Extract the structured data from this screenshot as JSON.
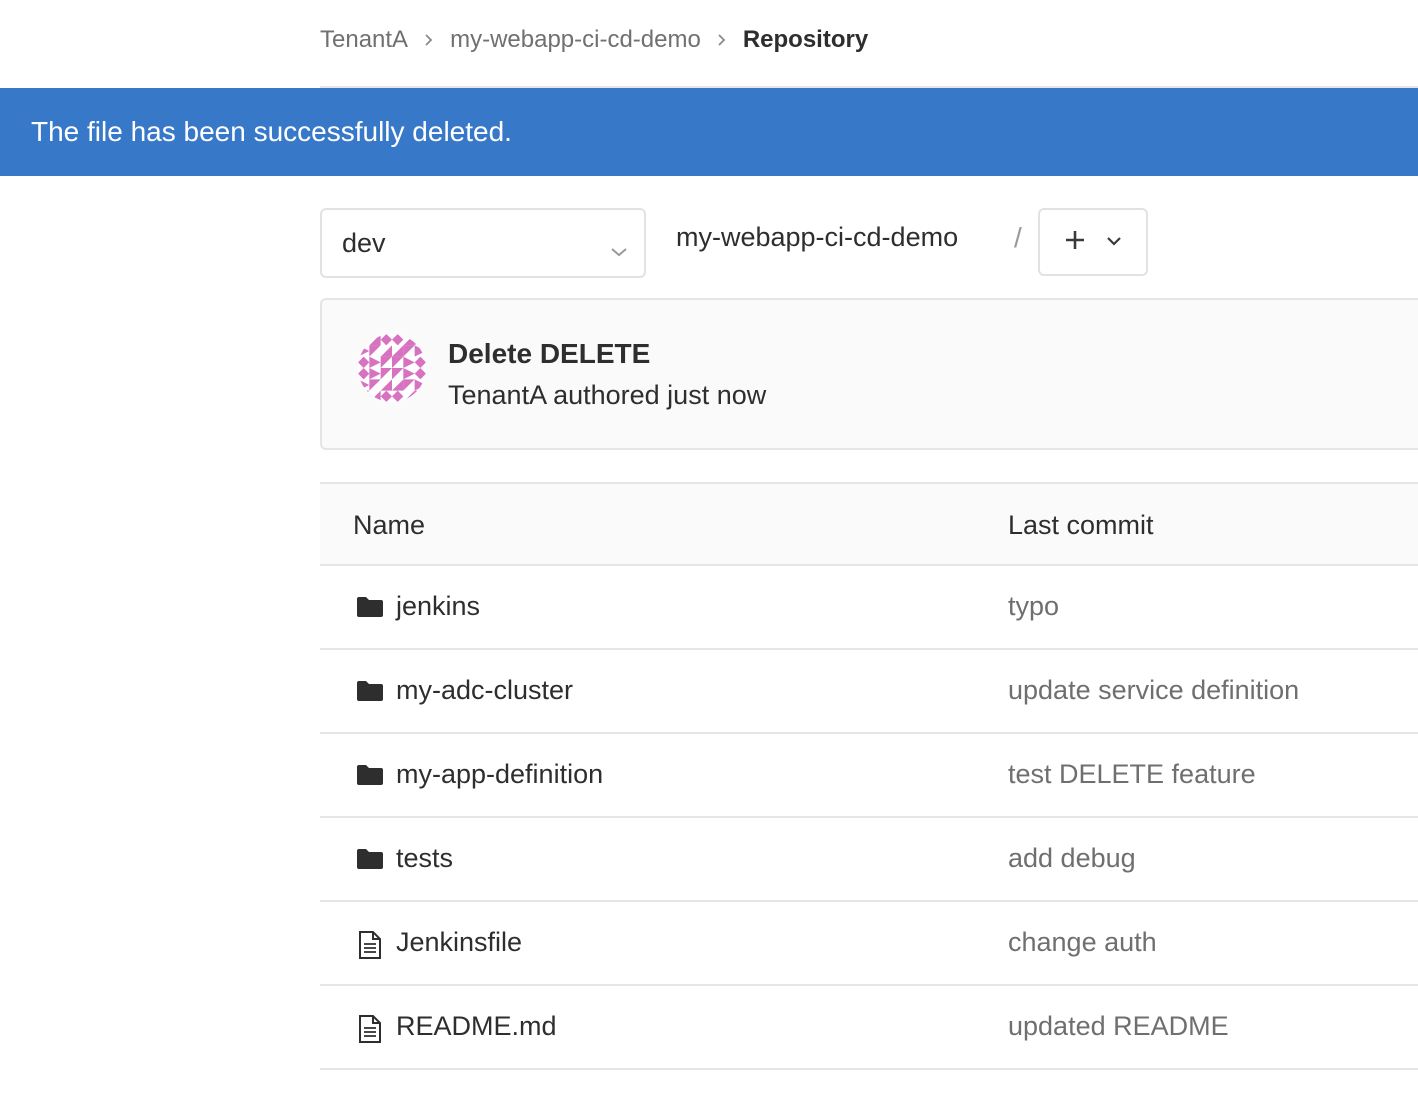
{
  "breadcrumb": {
    "items": [
      "TenantA",
      "my-webapp-ci-cd-demo"
    ],
    "current": "Repository"
  },
  "flash": {
    "message": "The file has been successfully deleted."
  },
  "tree_controls": {
    "branch": "dev",
    "project_path": "my-webapp-ci-cd-demo",
    "separator": "/",
    "add_icon": "plus-icon",
    "chevron_icon": "chevron-down-icon"
  },
  "last_commit": {
    "title": "Delete DELETE",
    "meta": "TenantA authored just now",
    "avatar_color": "#d672c0"
  },
  "table": {
    "headers": {
      "name": "Name",
      "last_commit": "Last commit"
    },
    "rows": [
      {
        "type": "folder",
        "name": "jenkins",
        "commit": "typo"
      },
      {
        "type": "folder",
        "name": "my-adc-cluster",
        "commit": "update service definition"
      },
      {
        "type": "folder",
        "name": "my-app-definition",
        "commit": "test DELETE feature"
      },
      {
        "type": "folder",
        "name": "tests",
        "commit": "add debug"
      },
      {
        "type": "file",
        "name": "Jenkinsfile",
        "commit": "change auth"
      },
      {
        "type": "file",
        "name": "README.md",
        "commit": "updated README"
      }
    ]
  },
  "colors": {
    "flash_bg": "#3878c9",
    "border": "#e5e5e5",
    "muted_text": "#6f6f6f"
  }
}
